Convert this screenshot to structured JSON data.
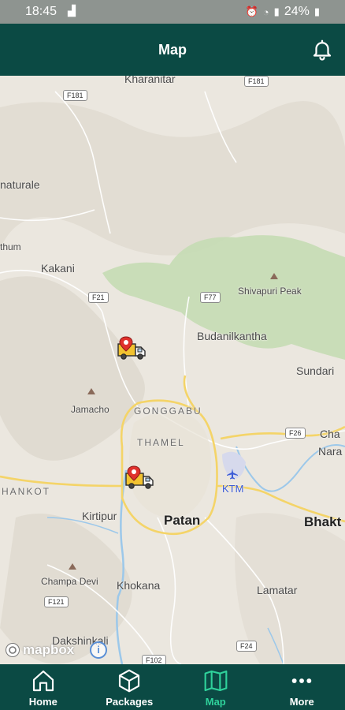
{
  "status": {
    "time": "18:45",
    "battery": "24%"
  },
  "header": {
    "title": "Map"
  },
  "map": {
    "places": {
      "kharanitar": "Kharanitar",
      "naturale": "naturale",
      "thum": "thum",
      "kakani": "Kakani",
      "shivapuri_peak": "Shivapuri Peak",
      "budanilkantha": "Budanilkantha",
      "sundari": "Sundari",
      "jamacho": "Jamacho",
      "gonggabu": "GONGGABU",
      "thamel": "THAMEL",
      "ktm": "KTM",
      "hankot": "HANKOT",
      "kirtipur": "Kirtipur",
      "patan": "Patan",
      "bhakt": "Bhakt",
      "cha": "Cha",
      "nara": "Nara",
      "champa_devi": "Champa Devi",
      "khokana": "Khokana",
      "lamatar": "Lamatar",
      "dakshinkali": "Dakshinkali"
    },
    "roads": {
      "f181_top": "F181",
      "f181_left": "F181",
      "f21": "F21",
      "f77": "F77",
      "f26": "F26",
      "f121": "F121",
      "f24": "F24",
      "f102": "F102"
    },
    "attribution": "mapbox",
    "info_glyph": "i"
  },
  "nav": {
    "items": [
      {
        "label": "Home",
        "icon": "home-icon"
      },
      {
        "label": "Packages",
        "icon": "box-icon"
      },
      {
        "label": "Map",
        "icon": "map-icon"
      },
      {
        "label": "More",
        "icon": "more-dots-icon"
      }
    ],
    "active": "Map"
  },
  "colors": {
    "primary": "#0b4a44",
    "active": "#2fd29b",
    "statusbar": "#8e9490",
    "marker_truck": "#f2c230",
    "marker_pin": "#e0312c"
  }
}
